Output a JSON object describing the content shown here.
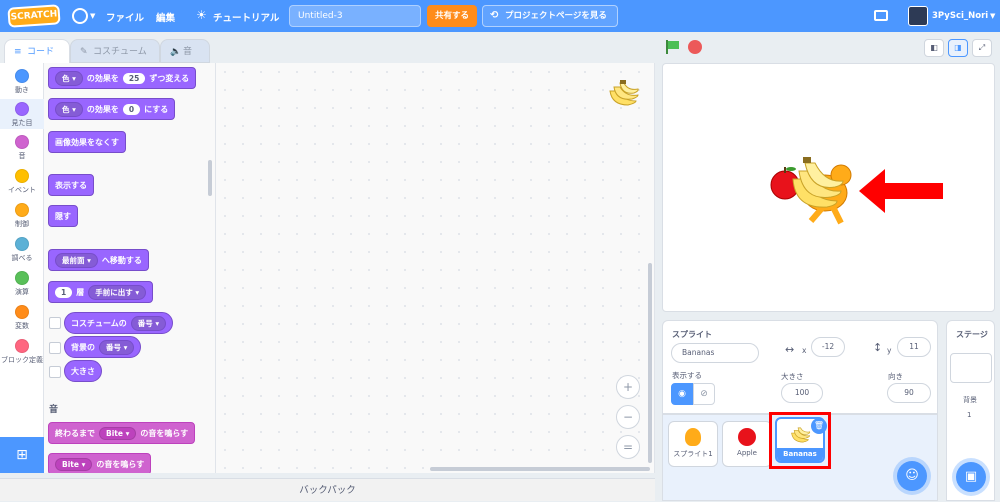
{
  "menubar": {
    "logo": "SCRATCH",
    "file": "ファイル",
    "edit": "編集",
    "tutorial": "チュートリアル",
    "project_title": "Untitled-3",
    "share": "共有する",
    "project_page": "プロジェクトページを見る",
    "username": "3PySci_Nori"
  },
  "tabs": {
    "code": "コード",
    "costume": "コスチューム",
    "sound": "音"
  },
  "categories": [
    {
      "label": "動き",
      "color": "#4c97ff"
    },
    {
      "label": "見た目",
      "color": "#9966ff"
    },
    {
      "label": "音",
      "color": "#cf63cf"
    },
    {
      "label": "イベント",
      "color": "#ffbf00"
    },
    {
      "label": "制御",
      "color": "#ffab19"
    },
    {
      "label": "調べる",
      "color": "#5cb1d6"
    },
    {
      "label": "演算",
      "color": "#59c059"
    },
    {
      "label": "変数",
      "color": "#ff8c1a"
    },
    {
      "label": "ブロック定義",
      "color": "#ff6680"
    }
  ],
  "blocks": {
    "b1_dd": "色",
    "b1_a": "の効果を",
    "b1_num": "25",
    "b1_b": "ずつ変える",
    "b2_dd": "色",
    "b2_a": "の効果を",
    "b2_num": "0",
    "b2_b": "にする",
    "b3": "画像効果をなくす",
    "b4": "表示する",
    "b5": "隠す",
    "b6_dd": "最前面",
    "b6_b": "へ移動する",
    "b7_num": "1",
    "b7_a": "層",
    "b7_dd": "手前に出す",
    "b8_a": "コスチュームの",
    "b8_dd": "番号",
    "b9_a": "背景の",
    "b9_dd": "番号",
    "b10": "大きさ",
    "sound_section": "音",
    "s1_a": "終わるまで",
    "s1_dd": "Bite",
    "s1_b": "の音を鳴らす",
    "s2_dd": "Bite",
    "s2_b": "の音を鳴らす"
  },
  "zoom": {
    "in": "+",
    "out": "−",
    "reset": "="
  },
  "backpack": "バックパック",
  "sprite_info": {
    "title": "スプライト",
    "name": "Bananas",
    "x_label": "x",
    "x": "-12",
    "y_label": "y",
    "y": "11",
    "show_label": "表示する",
    "size_label": "大きさ",
    "size": "100",
    "direction_label": "向き",
    "direction": "90"
  },
  "sprites": [
    {
      "name": "スプライト1"
    },
    {
      "name": "Apple"
    },
    {
      "name": "Bananas"
    }
  ],
  "stage_pane": {
    "title": "ステージ",
    "backdrop_label": "背景",
    "backdrop_count": "1"
  },
  "colors": {
    "accent": "#4c97ff",
    "looks": "#9966ff",
    "sound": "#cf63cf",
    "highlight": "#ff0000"
  }
}
